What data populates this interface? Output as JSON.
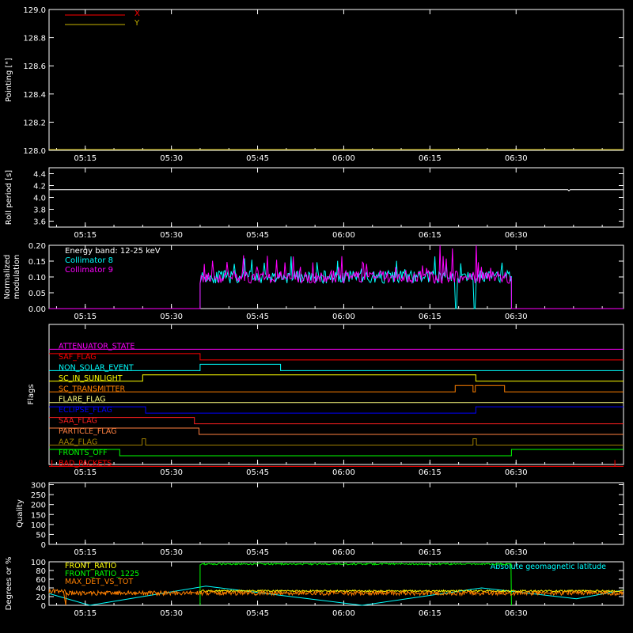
{
  "time_axis": {
    "ticks": [
      "05:15",
      "05:30",
      "05:45",
      "06:00",
      "06:15",
      "06:30"
    ],
    "tick_minutes": [
      315,
      330,
      345,
      360,
      375,
      390
    ],
    "start_minutes": 308.7,
    "end_minutes": 408.7
  },
  "chart_data": [
    {
      "id": "pointing",
      "type": "line",
      "ylabel": "Pointing [\"]",
      "ylim": [
        128.0,
        129.0
      ],
      "yticks": [
        "128.0",
        "128.2",
        "128.4",
        "128.6",
        "128.8",
        "129.0"
      ],
      "legend": [
        {
          "name": "X",
          "color": "#ff0000"
        },
        {
          "name": "Y",
          "color": "#c8b400"
        }
      ],
      "series": [
        {
          "name": "Y",
          "color": "#c8b400",
          "x": [
            308.7,
            408.7
          ],
          "y": [
            128.0,
            128.0
          ]
        }
      ]
    },
    {
      "id": "roll",
      "type": "line",
      "ylabel": "Roll period [s]",
      "ylim": [
        3.5,
        4.5
      ],
      "yticks": [
        "3.6",
        "3.8",
        "4.0",
        "4.2",
        "4.4"
      ],
      "series": [
        {
          "name": "roll",
          "color": "#ffffff",
          "x": [
            308.7,
            399.0,
            399.2,
            399.4,
            408.7
          ],
          "y": [
            4.13,
            4.13,
            4.11,
            4.13,
            4.13
          ]
        }
      ]
    },
    {
      "id": "modulation",
      "type": "line",
      "ylabel_lines": [
        "Normalized",
        "modulation"
      ],
      "ylim": [
        0.0,
        0.2
      ],
      "yticks": [
        "0.00",
        "0.05",
        "0.10",
        "0.15",
        "0.20"
      ],
      "annotation": "Energy band: 12-25 keV",
      "legend": [
        {
          "name": "Collimator 8",
          "color": "#00ffff"
        },
        {
          "name": "Collimator 9",
          "color": "#ff00ff"
        }
      ],
      "active_range": [
        335.0,
        389.2
      ],
      "level": 0.1,
      "series": [
        {
          "name": "Collimator 8",
          "color": "#00ffff",
          "dropouts": [
            [
              379.4,
              382.6
            ]
          ]
        },
        {
          "name": "Collimator 9",
          "color": "#ff00ff",
          "spikes": [
            [
              376.7,
              0.2
            ],
            [
              383.1,
              0.2
            ],
            [
              378.9,
              0.19
            ]
          ]
        }
      ]
    },
    {
      "id": "flags",
      "type": "line",
      "ylabel": "Flags",
      "flags": [
        {
          "label": "ATTENUATOR_STATE",
          "color": "#ff00ff",
          "x": [
            308.7,
            408.7
          ],
          "y": [
            0,
            0
          ]
        },
        {
          "label": "SAF_FLAG",
          "color": "#ff0000",
          "x": [
            308.7,
            335.0,
            335.0,
            408.7
          ],
          "y": [
            1,
            1,
            0,
            0
          ]
        },
        {
          "label": "NON_SOLAR_EVENT",
          "color": "#00ffff",
          "x": [
            308.7,
            335.0,
            335.0,
            349.0,
            349.0,
            408.7
          ],
          "y": [
            0,
            0,
            1,
            1,
            0,
            0
          ]
        },
        {
          "label": "SC_IN_SUNLIGHT",
          "color": "#ffff00",
          "x": [
            308.7,
            325.0,
            325.0,
            383.0,
            383.0,
            408.7
          ],
          "y": [
            0,
            0,
            1,
            1,
            0,
            0
          ]
        },
        {
          "label": "SC_TRANSMITTER",
          "color": "#ff8000",
          "x": [
            308.7,
            379.4,
            379.4,
            382.5,
            382.5,
            382.9,
            382.9,
            388.0,
            388.0,
            408.7
          ],
          "y": [
            0,
            0,
            1,
            1,
            0,
            0,
            1,
            1,
            0,
            0
          ]
        },
        {
          "label": "FLARE_FLAG",
          "color": "#ffff80",
          "x": [
            308.7,
            408.7
          ],
          "y": [
            0,
            0
          ]
        },
        {
          "label": "ECLIPSE_FLAG",
          "color": "#0000ff",
          "x": [
            308.7,
            325.5,
            325.5,
            383.0,
            383.0,
            408.7
          ],
          "y": [
            1,
            1,
            0,
            0,
            1,
            1
          ]
        },
        {
          "label": "SAA_FLAG",
          "color": "#ff2020",
          "x": [
            308.7,
            334.0,
            334.0,
            408.7
          ],
          "y": [
            1,
            1,
            0,
            0
          ]
        },
        {
          "label": "PARTICLE_FLAG",
          "color": "#ff8040",
          "x": [
            308.7,
            334.8,
            334.8,
            408.7
          ],
          "y": [
            1,
            1,
            0,
            0
          ]
        },
        {
          "label": "AAZ_FLAG",
          "color": "#a08000",
          "x": [
            308.7,
            324.9,
            324.9,
            325.5,
            325.5,
            382.5,
            382.5,
            383.1,
            383.1,
            408.7
          ],
          "y": [
            0,
            0,
            1,
            1,
            0,
            0,
            1,
            1,
            0,
            0
          ]
        },
        {
          "label": "FRONTS_OFF",
          "color": "#00ff00",
          "x": [
            308.7,
            321.0,
            321.0,
            389.2,
            389.2,
            408.7
          ],
          "y": [
            1,
            1,
            0,
            0,
            1,
            1
          ]
        },
        {
          "label": "BAD_PACKETS",
          "color": "#ff0000",
          "x": [
            308.7,
            408.7
          ],
          "y": [
            0,
            0
          ],
          "spikes": [
            309.2,
            407.2
          ]
        }
      ]
    },
    {
      "id": "quality",
      "type": "line",
      "ylabel": "Quality",
      "ylim": [
        0,
        310
      ],
      "yticks": [
        "0",
        "50",
        "100",
        "150",
        "200",
        "250",
        "300"
      ],
      "series": []
    },
    {
      "id": "ratios",
      "type": "line",
      "ylabel": "Degrees or %",
      "ylim": [
        0,
        100
      ],
      "yticks": [
        "0",
        "20",
        "40",
        "60",
        "80",
        "100"
      ],
      "legend": [
        {
          "name": "FRONT_RATIO",
          "color": "#ffff00"
        },
        {
          "name": "FRONT_RATIO_1225",
          "color": "#00ff00"
        },
        {
          "name": "MAX_DET_VS_TOT",
          "color": "#ff8000"
        }
      ],
      "right_label": {
        "name": "Absolute geomagnetic latitude",
        "color": "#00ffff"
      },
      "series": [
        {
          "name": "Absolute geomagnetic latitude",
          "color": "#00ffff",
          "x": [
            308.7,
            315.8,
            336.0,
            363.2,
            384.0,
            400.5,
            408.7
          ],
          "y": [
            27,
            0,
            44,
            0,
            40,
            15,
            35
          ]
        },
        {
          "name": "FRONT_RATIO_1225",
          "color": "#00ff00",
          "x": [
            335.0,
            389.2
          ],
          "level": 95
        },
        {
          "name": "FRONT_RATIO",
          "color": "#ffff00",
          "x": [
            335.0,
            408.7
          ],
          "level": 33
        },
        {
          "name": "MAX_DET_VS_TOT",
          "color": "#ff8000",
          "x": [
            308.7,
            408.7
          ],
          "level": 28
        }
      ]
    }
  ]
}
